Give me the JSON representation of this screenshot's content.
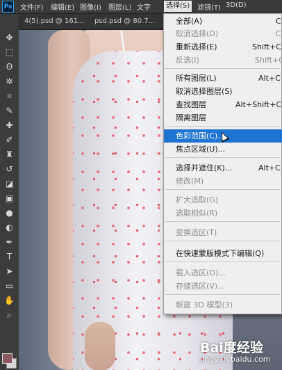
{
  "menubar": {
    "logo": "Ps",
    "items": [
      "文件(F)",
      "编辑(E)",
      "图像(I)",
      "图层(L)",
      "文字",
      "选择(S)",
      "滤镜(T)",
      "3D(D)"
    ]
  },
  "tabs": [
    "4(5).psd @ 161...",
    "psd.psd @ 80.7..."
  ],
  "tools": [
    "move-icon",
    "marquee-icon",
    "lasso-icon",
    "magic-wand-icon",
    "crop-icon",
    "eyedropper-icon",
    "healing-icon",
    "brush-icon",
    "stamp-icon",
    "history-brush-icon",
    "eraser-icon",
    "gradient-icon",
    "blur-icon",
    "dodge-icon",
    "pen-icon",
    "type-icon",
    "path-select-icon",
    "shape-icon",
    "hand-icon",
    "zoom-icon"
  ],
  "colors": {
    "foreground": "#8a5a60",
    "background": "#d8d8d8",
    "highlight": "#1e74d0"
  },
  "select_menu": {
    "items": [
      {
        "label": "全部(A)",
        "shortcut": "C",
        "disabled": false
      },
      {
        "label": "取消选择(D)",
        "shortcut": "C",
        "disabled": true
      },
      {
        "label": "重新选择(E)",
        "shortcut": "Shift+C",
        "disabled": false
      },
      {
        "label": "反选(I)",
        "shortcut": "Shift+C",
        "disabled": true
      },
      {
        "label": "所有图层(L)",
        "shortcut": "Alt+C",
        "disabled": false
      },
      {
        "label": "取消选择图层(S)",
        "shortcut": "",
        "disabled": false
      },
      {
        "label": "查找图层",
        "shortcut": "Alt+Shift+C",
        "disabled": false
      },
      {
        "label": "隔离图层",
        "shortcut": "",
        "disabled": false
      },
      {
        "label": "色彩范围(C)...",
        "shortcut": "",
        "disabled": false,
        "highlighted": true
      },
      {
        "label": "焦点区域(U)...",
        "shortcut": "",
        "disabled": false
      },
      {
        "label": "选择并遮住(K)...",
        "shortcut": "Alt+C",
        "disabled": false
      },
      {
        "label": "修改(M)",
        "shortcut": "",
        "disabled": true
      },
      {
        "label": "扩大选取(G)",
        "shortcut": "",
        "disabled": true
      },
      {
        "label": "选取相似(R)",
        "shortcut": "",
        "disabled": true
      },
      {
        "label": "变换选区(T)",
        "shortcut": "",
        "disabled": true
      },
      {
        "label": "在快速蒙版模式下编辑(Q)",
        "shortcut": "",
        "disabled": false
      },
      {
        "label": "载入选区(O)...",
        "shortcut": "",
        "disabled": true
      },
      {
        "label": "存储选区(V)...",
        "shortcut": "",
        "disabled": true
      },
      {
        "label": "新建 3D 模型(3)",
        "shortcut": "",
        "disabled": true
      }
    ]
  },
  "watermark": {
    "logo": "Bai度经验",
    "url": "jingyan.baidu.com"
  }
}
